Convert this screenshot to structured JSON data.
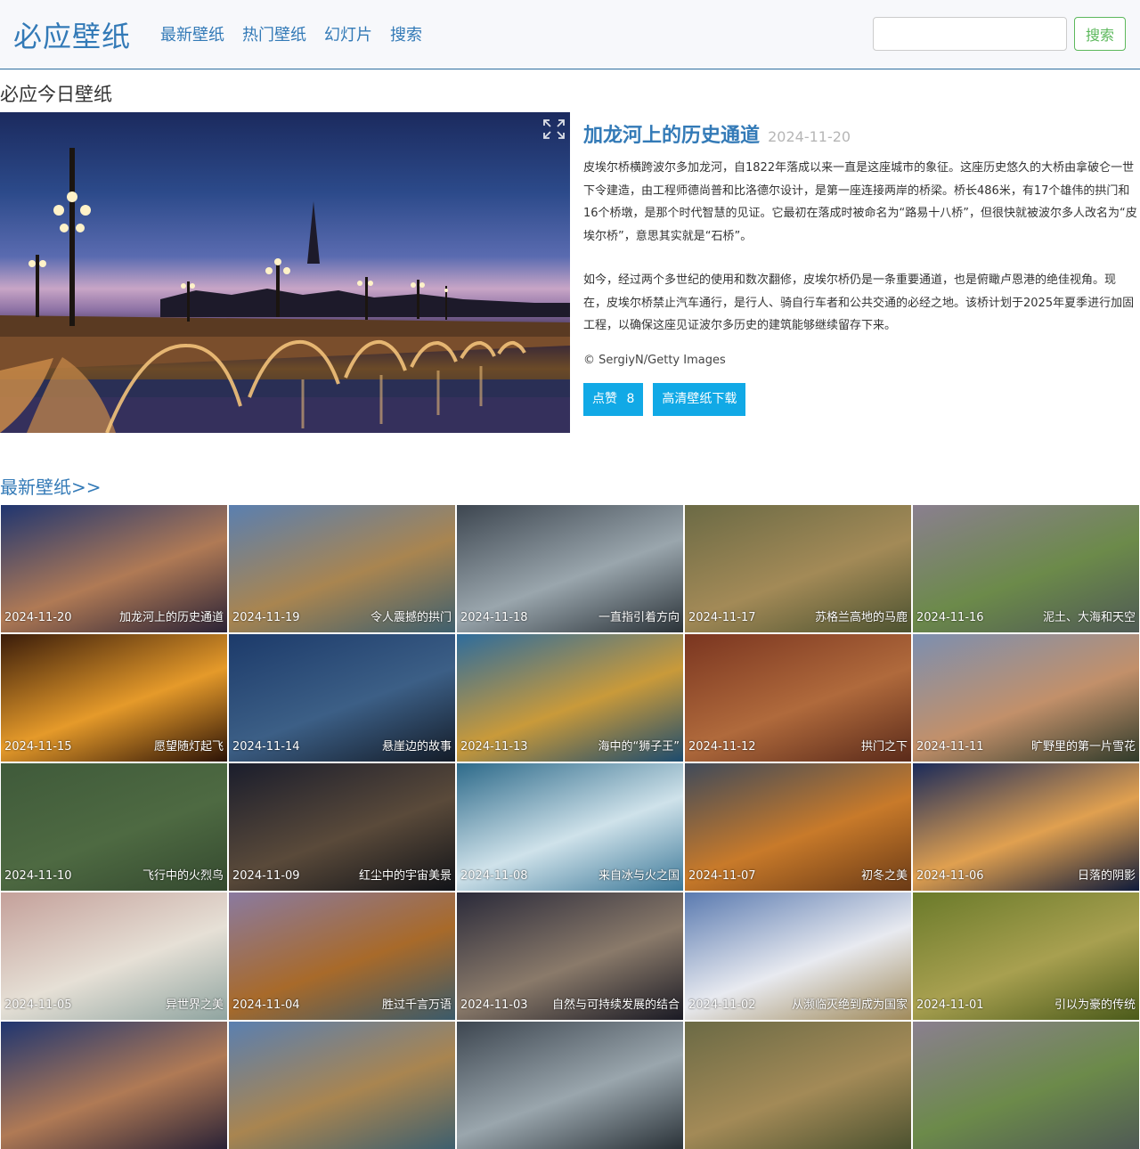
{
  "navbar": {
    "brand": "必应壁纸",
    "links": [
      "最新壁纸",
      "热门壁纸",
      "幻灯片",
      "搜索"
    ],
    "search_placeholder": "",
    "search_button": "搜索"
  },
  "today": {
    "section_title": "必应今日壁纸",
    "title": "加龙河上的历史通道",
    "date": "2024-11-20",
    "paragraph1": "皮埃尔桥横跨波尔多加龙河，自1822年落成以来一直是这座城市的象征。这座历史悠久的大桥由拿破仑一世下令建造，由工程师德尚普和比洛德尔设计，是第一座连接两岸的桥梁。桥长486米，有17个雄伟的拱门和16个桥墩，是那个时代智慧的见证。它最初在落成时被命名为“路易十八桥”，但很快就被波尔多人改名为“皮埃尔桥”，意思其实就是“石桥”。",
    "paragraph2": "如今，经过两个多世纪的使用和数次翻修，皮埃尔桥仍是一条重要通道，也是俯瞰卢恩港的绝佳视角。现在，皮埃尔桥禁止汽车通行，是行人、骑自行车者和公共交通的必经之地。该桥计划于2025年夏季进行加固工程，以确保这座见证波尔多历史的建筑能够继续留存下来。",
    "copyright": "© SergiyN/Getty Images",
    "like_label": "点赞",
    "like_count": "8",
    "download_label": "高清壁纸下载"
  },
  "latest": {
    "link_label": "最新壁纸>>",
    "tiles": [
      {
        "date": "2024-11-20",
        "title": "加龙河上的历史通道",
        "c1": "#1f3570",
        "c2": "#b07a55",
        "c3": "#2a2236"
      },
      {
        "date": "2024-11-19",
        "title": "令人震撼的拱门",
        "c1": "#5a7fb0",
        "c2": "#a98550",
        "c3": "#3e5f6e"
      },
      {
        "date": "2024-11-18",
        "title": "一直指引着方向",
        "c1": "#3d4650",
        "c2": "#9aa6ad",
        "c3": "#2a3238"
      },
      {
        "date": "2024-11-17",
        "title": "苏格兰高地的马鹿",
        "c1": "#6b6a45",
        "c2": "#a38a57",
        "c3": "#4c5230"
      },
      {
        "date": "2024-11-16",
        "title": "泥土、大海和天空",
        "c1": "#8a7f8f",
        "c2": "#6c8a4a",
        "c3": "#4f5a55"
      },
      {
        "date": "2024-11-15",
        "title": "愿望随灯起飞",
        "c1": "#3a1c0a",
        "c2": "#e59a2a",
        "c3": "#2b1206"
      },
      {
        "date": "2024-11-14",
        "title": "悬崖边的故事",
        "c1": "#1c3a6a",
        "c2": "#3c5f86",
        "c3": "#141c28"
      },
      {
        "date": "2024-11-13",
        "title": "海中的“狮子王”",
        "c1": "#2e6c9c",
        "c2": "#c99a3a",
        "c3": "#1c4b6e"
      },
      {
        "date": "2024-11-12",
        "title": "拱门之下",
        "c1": "#7a3520",
        "c2": "#b06a3c",
        "c3": "#5a2a1a"
      },
      {
        "date": "2024-11-11",
        "title": "旷野里的第一片雪花",
        "c1": "#7c8fb0",
        "c2": "#c2906a",
        "c3": "#2f3a2a"
      },
      {
        "date": "2024-11-10",
        "title": "飞行中的火烈鸟",
        "c1": "#3f5a3a",
        "c2": "#4e6a42",
        "c3": "#34492f"
      },
      {
        "date": "2024-11-09",
        "title": "红尘中的宇宙美景",
        "c1": "#1a1d2c",
        "c2": "#5a4a3a",
        "c3": "#111318"
      },
      {
        "date": "2024-11-08",
        "title": "来自冰与火之国",
        "c1": "#2d6a8a",
        "c2": "#cfe2ea",
        "c3": "#3c7898"
      },
      {
        "date": "2024-11-07",
        "title": "初冬之美",
        "c1": "#3f4a5a",
        "c2": "#c87a2a",
        "c3": "#6a3a16"
      },
      {
        "date": "2024-11-06",
        "title": "日落的阴影",
        "c1": "#1a2a5a",
        "c2": "#e0a050",
        "c3": "#0e1a3a"
      },
      {
        "date": "2024-11-05",
        "title": "异世界之美",
        "c1": "#c4a09a",
        "c2": "#e6e0d6",
        "c3": "#8fa4a0"
      },
      {
        "date": "2024-11-04",
        "title": "胜过千言万语",
        "c1": "#8a7aa0",
        "c2": "#a86a2a",
        "c3": "#3a5a6a"
      },
      {
        "date": "2024-11-03",
        "title": "自然与可持续发展的结合",
        "c1": "#2a2a3a",
        "c2": "#8a7a6a",
        "c3": "#1a1a24"
      },
      {
        "date": "2024-11-02",
        "title": "从濒临灭绝到成为国家",
        "c1": "#5a7ab0",
        "c2": "#e8eaf0",
        "c3": "#a08a5a"
      },
      {
        "date": "2024-11-01",
        "title": "引以为豪的传统",
        "c1": "#6a7a2a",
        "c2": "#a8a050",
        "c3": "#4a5a1a"
      }
    ]
  },
  "colors": {
    "brand": "#337ab7",
    "success": "#5cb85c",
    "info": "#11a9e6"
  }
}
